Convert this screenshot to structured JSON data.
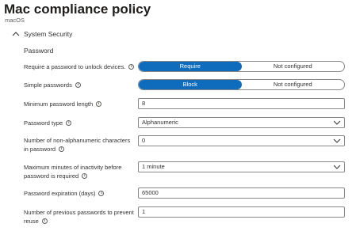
{
  "header": {
    "title": "Mac compliance policy",
    "more_icon": "ellipsis-icon",
    "more_label": "···",
    "subtitle": "macOS"
  },
  "section": {
    "title": "System Security",
    "expanded": true,
    "group_label": "Password"
  },
  "settings": [
    {
      "label": "Require a password to unlock devices.",
      "options": [
        "Require",
        "Not configured"
      ],
      "selected": "Require"
    },
    {
      "label": "Simple passwords",
      "options": [
        "Block",
        "Not configured"
      ],
      "selected": "Block"
    },
    {
      "label": "Minimum password length",
      "value": "8"
    },
    {
      "label": "Password type",
      "value": "Alphanumeric"
    },
    {
      "label": "Number of non-alphanumeric characters in password",
      "value": "0"
    },
    {
      "label": "Maximum minutes of inactivity before password is required",
      "value": "1 minute"
    },
    {
      "label": "Password expiration (days)",
      "value": "65000"
    },
    {
      "label": "Number of previous passwords to prevent reuse",
      "value": "1"
    }
  ],
  "colors": {
    "accent": "#0f6cbd",
    "border": "#8a8886",
    "text": "#323130"
  }
}
